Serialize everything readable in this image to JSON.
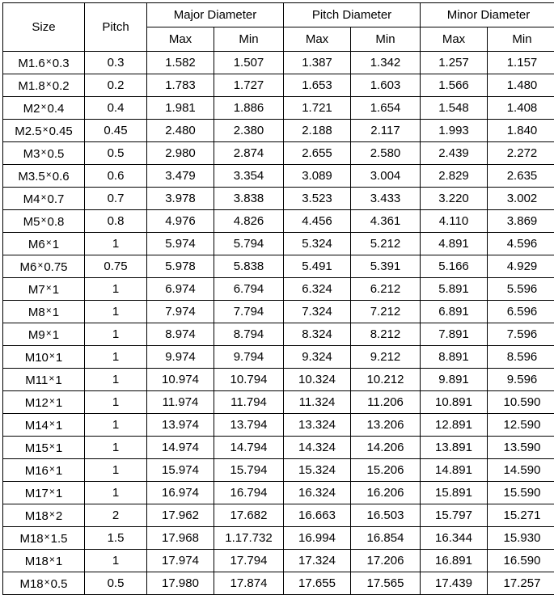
{
  "table": {
    "group_headers": [
      {
        "label": "Size",
        "span": 1,
        "rowspan": 2
      },
      {
        "label": "Pitch",
        "span": 1,
        "rowspan": 2
      },
      {
        "label": "Major Diameter",
        "span": 2,
        "rowspan": 1
      },
      {
        "label": "Pitch Diameter",
        "span": 2,
        "rowspan": 1
      },
      {
        "label": "Minor Diameter",
        "span": 2,
        "rowspan": 1
      }
    ],
    "sub_headers": [
      "Max",
      "Min",
      "Max",
      "Min",
      "Max",
      "Min"
    ],
    "columns": [
      "Size",
      "Pitch",
      "Major Diameter Max",
      "Major Diameter Min",
      "Pitch Diameter Max",
      "Pitch Diameter Min",
      "Minor Diameter Max",
      "Minor Diameter Min"
    ],
    "multiplication_sign": "×",
    "rows": [
      {
        "size_prefix": "M1.6",
        "size_suffix": "0.3",
        "pitch": "0.3",
        "major_max": "1.582",
        "major_min": "1.507",
        "pitch_max": "1.387",
        "pitch_min": "1.342",
        "minor_max": "1.257",
        "minor_min": "1.157"
      },
      {
        "size_prefix": "M1.8",
        "size_suffix": "0.2",
        "pitch": "0.2",
        "major_max": "1.783",
        "major_min": "1.727",
        "pitch_max": "1.653",
        "pitch_min": "1.603",
        "minor_max": "1.566",
        "minor_min": "1.480"
      },
      {
        "size_prefix": "M2",
        "size_suffix": "0.4",
        "pitch": "0.4",
        "major_max": "1.981",
        "major_min": "1.886",
        "pitch_max": "1.721",
        "pitch_min": "1.654",
        "minor_max": "1.548",
        "minor_min": "1.408"
      },
      {
        "size_prefix": "M2.5",
        "size_suffix": "0.45",
        "pitch": "0.45",
        "major_max": "2.480",
        "major_min": "2.380",
        "pitch_max": "2.188",
        "pitch_min": "2.117",
        "minor_max": "1.993",
        "minor_min": "1.840"
      },
      {
        "size_prefix": "M3",
        "size_suffix": "0.5",
        "pitch": "0.5",
        "major_max": "2.980",
        "major_min": "2.874",
        "pitch_max": "2.655",
        "pitch_min": "2.580",
        "minor_max": "2.439",
        "minor_min": "2.272"
      },
      {
        "size_prefix": "M3.5",
        "size_suffix": "0.6",
        "pitch": "0.6",
        "major_max": "3.479",
        "major_min": "3.354",
        "pitch_max": "3.089",
        "pitch_min": "3.004",
        "minor_max": "2.829",
        "minor_min": "2.635"
      },
      {
        "size_prefix": "M4",
        "size_suffix": "0.7",
        "pitch": "0.7",
        "major_max": "3.978",
        "major_min": "3.838",
        "pitch_max": "3.523",
        "pitch_min": "3.433",
        "minor_max": "3.220",
        "minor_min": "3.002"
      },
      {
        "size_prefix": "M5",
        "size_suffix": "0.8",
        "pitch": "0.8",
        "major_max": "4.976",
        "major_min": "4.826",
        "pitch_max": "4.456",
        "pitch_min": "4.361",
        "minor_max": "4.110",
        "minor_min": "3.869"
      },
      {
        "size_prefix": "M6",
        "size_suffix": "1",
        "pitch": "1",
        "major_max": "5.974",
        "major_min": "5.794",
        "pitch_max": "5.324",
        "pitch_min": "5.212",
        "minor_max": "4.891",
        "minor_min": "4.596"
      },
      {
        "size_prefix": "M6",
        "size_suffix": "0.75",
        "pitch": "0.75",
        "major_max": "5.978",
        "major_min": "5.838",
        "pitch_max": "5.491",
        "pitch_min": "5.391",
        "minor_max": "5.166",
        "minor_min": "4.929"
      },
      {
        "size_prefix": "M7",
        "size_suffix": "1",
        "pitch": "1",
        "major_max": "6.974",
        "major_min": "6.794",
        "pitch_max": "6.324",
        "pitch_min": "6.212",
        "minor_max": "5.891",
        "minor_min": "5.596"
      },
      {
        "size_prefix": "M8",
        "size_suffix": "1",
        "pitch": "1",
        "major_max": "7.974",
        "major_min": "7.794",
        "pitch_max": "7.324",
        "pitch_min": "7.212",
        "minor_max": "6.891",
        "minor_min": "6.596"
      },
      {
        "size_prefix": "M9",
        "size_suffix": "1",
        "pitch": "1",
        "major_max": "8.974",
        "major_min": "8.794",
        "pitch_max": "8.324",
        "pitch_min": "8.212",
        "minor_max": "7.891",
        "minor_min": "7.596"
      },
      {
        "size_prefix": "M10",
        "size_suffix": "1",
        "pitch": "1",
        "major_max": "9.974",
        "major_min": "9.794",
        "pitch_max": "9.324",
        "pitch_min": "9.212",
        "minor_max": "8.891",
        "minor_min": "8.596"
      },
      {
        "size_prefix": "M11",
        "size_suffix": "1",
        "pitch": "1",
        "major_max": "10.974",
        "major_min": "10.794",
        "pitch_max": "10.324",
        "pitch_min": "10.212",
        "minor_max": "9.891",
        "minor_min": "9.596"
      },
      {
        "size_prefix": "M12",
        "size_suffix": "1",
        "pitch": "1",
        "major_max": "11.974",
        "major_min": "11.794",
        "pitch_max": "11.324",
        "pitch_min": "11.206",
        "minor_max": "10.891",
        "minor_min": "10.590"
      },
      {
        "size_prefix": "M14",
        "size_suffix": "1",
        "pitch": "1",
        "major_max": "13.974",
        "major_min": "13.794",
        "pitch_max": "13.324",
        "pitch_min": "13.206",
        "minor_max": "12.891",
        "minor_min": "12.590"
      },
      {
        "size_prefix": "M15",
        "size_suffix": "1",
        "pitch": "1",
        "major_max": "14.974",
        "major_min": "14.794",
        "pitch_max": "14.324",
        "pitch_min": "14.206",
        "minor_max": "13.891",
        "minor_min": "13.590"
      },
      {
        "size_prefix": "M16",
        "size_suffix": "1",
        "pitch": "1",
        "major_max": "15.974",
        "major_min": "15.794",
        "pitch_max": "15.324",
        "pitch_min": "15.206",
        "minor_max": "14.891",
        "minor_min": "14.590"
      },
      {
        "size_prefix": "M17",
        "size_suffix": "1",
        "pitch": "1",
        "major_max": "16.974",
        "major_min": "16.794",
        "pitch_max": "16.324",
        "pitch_min": "16.206",
        "minor_max": "15.891",
        "minor_min": "15.590"
      },
      {
        "size_prefix": "M18",
        "size_suffix": "2",
        "pitch": "2",
        "major_max": "17.962",
        "major_min": "17.682",
        "pitch_max": "16.663",
        "pitch_min": "16.503",
        "minor_max": "15.797",
        "minor_min": "15.271"
      },
      {
        "size_prefix": "M18",
        "size_suffix": "1.5",
        "pitch": "1.5",
        "major_max": "17.968",
        "major_min": "1.17.732",
        "pitch_max": "16.994",
        "pitch_min": "16.854",
        "minor_max": "16.344",
        "minor_min": "15.930"
      },
      {
        "size_prefix": "M18",
        "size_suffix": "1",
        "pitch": "1",
        "major_max": "17.974",
        "major_min": "17.794",
        "pitch_max": "17.324",
        "pitch_min": "17.206",
        "minor_max": "16.891",
        "minor_min": "16.590"
      },
      {
        "size_prefix": "M18",
        "size_suffix": "0.5",
        "pitch": "0.5",
        "major_max": "17.980",
        "major_min": "17.874",
        "pitch_max": "17.655",
        "pitch_min": "17.565",
        "minor_max": "17.439",
        "minor_min": "17.257"
      }
    ]
  }
}
